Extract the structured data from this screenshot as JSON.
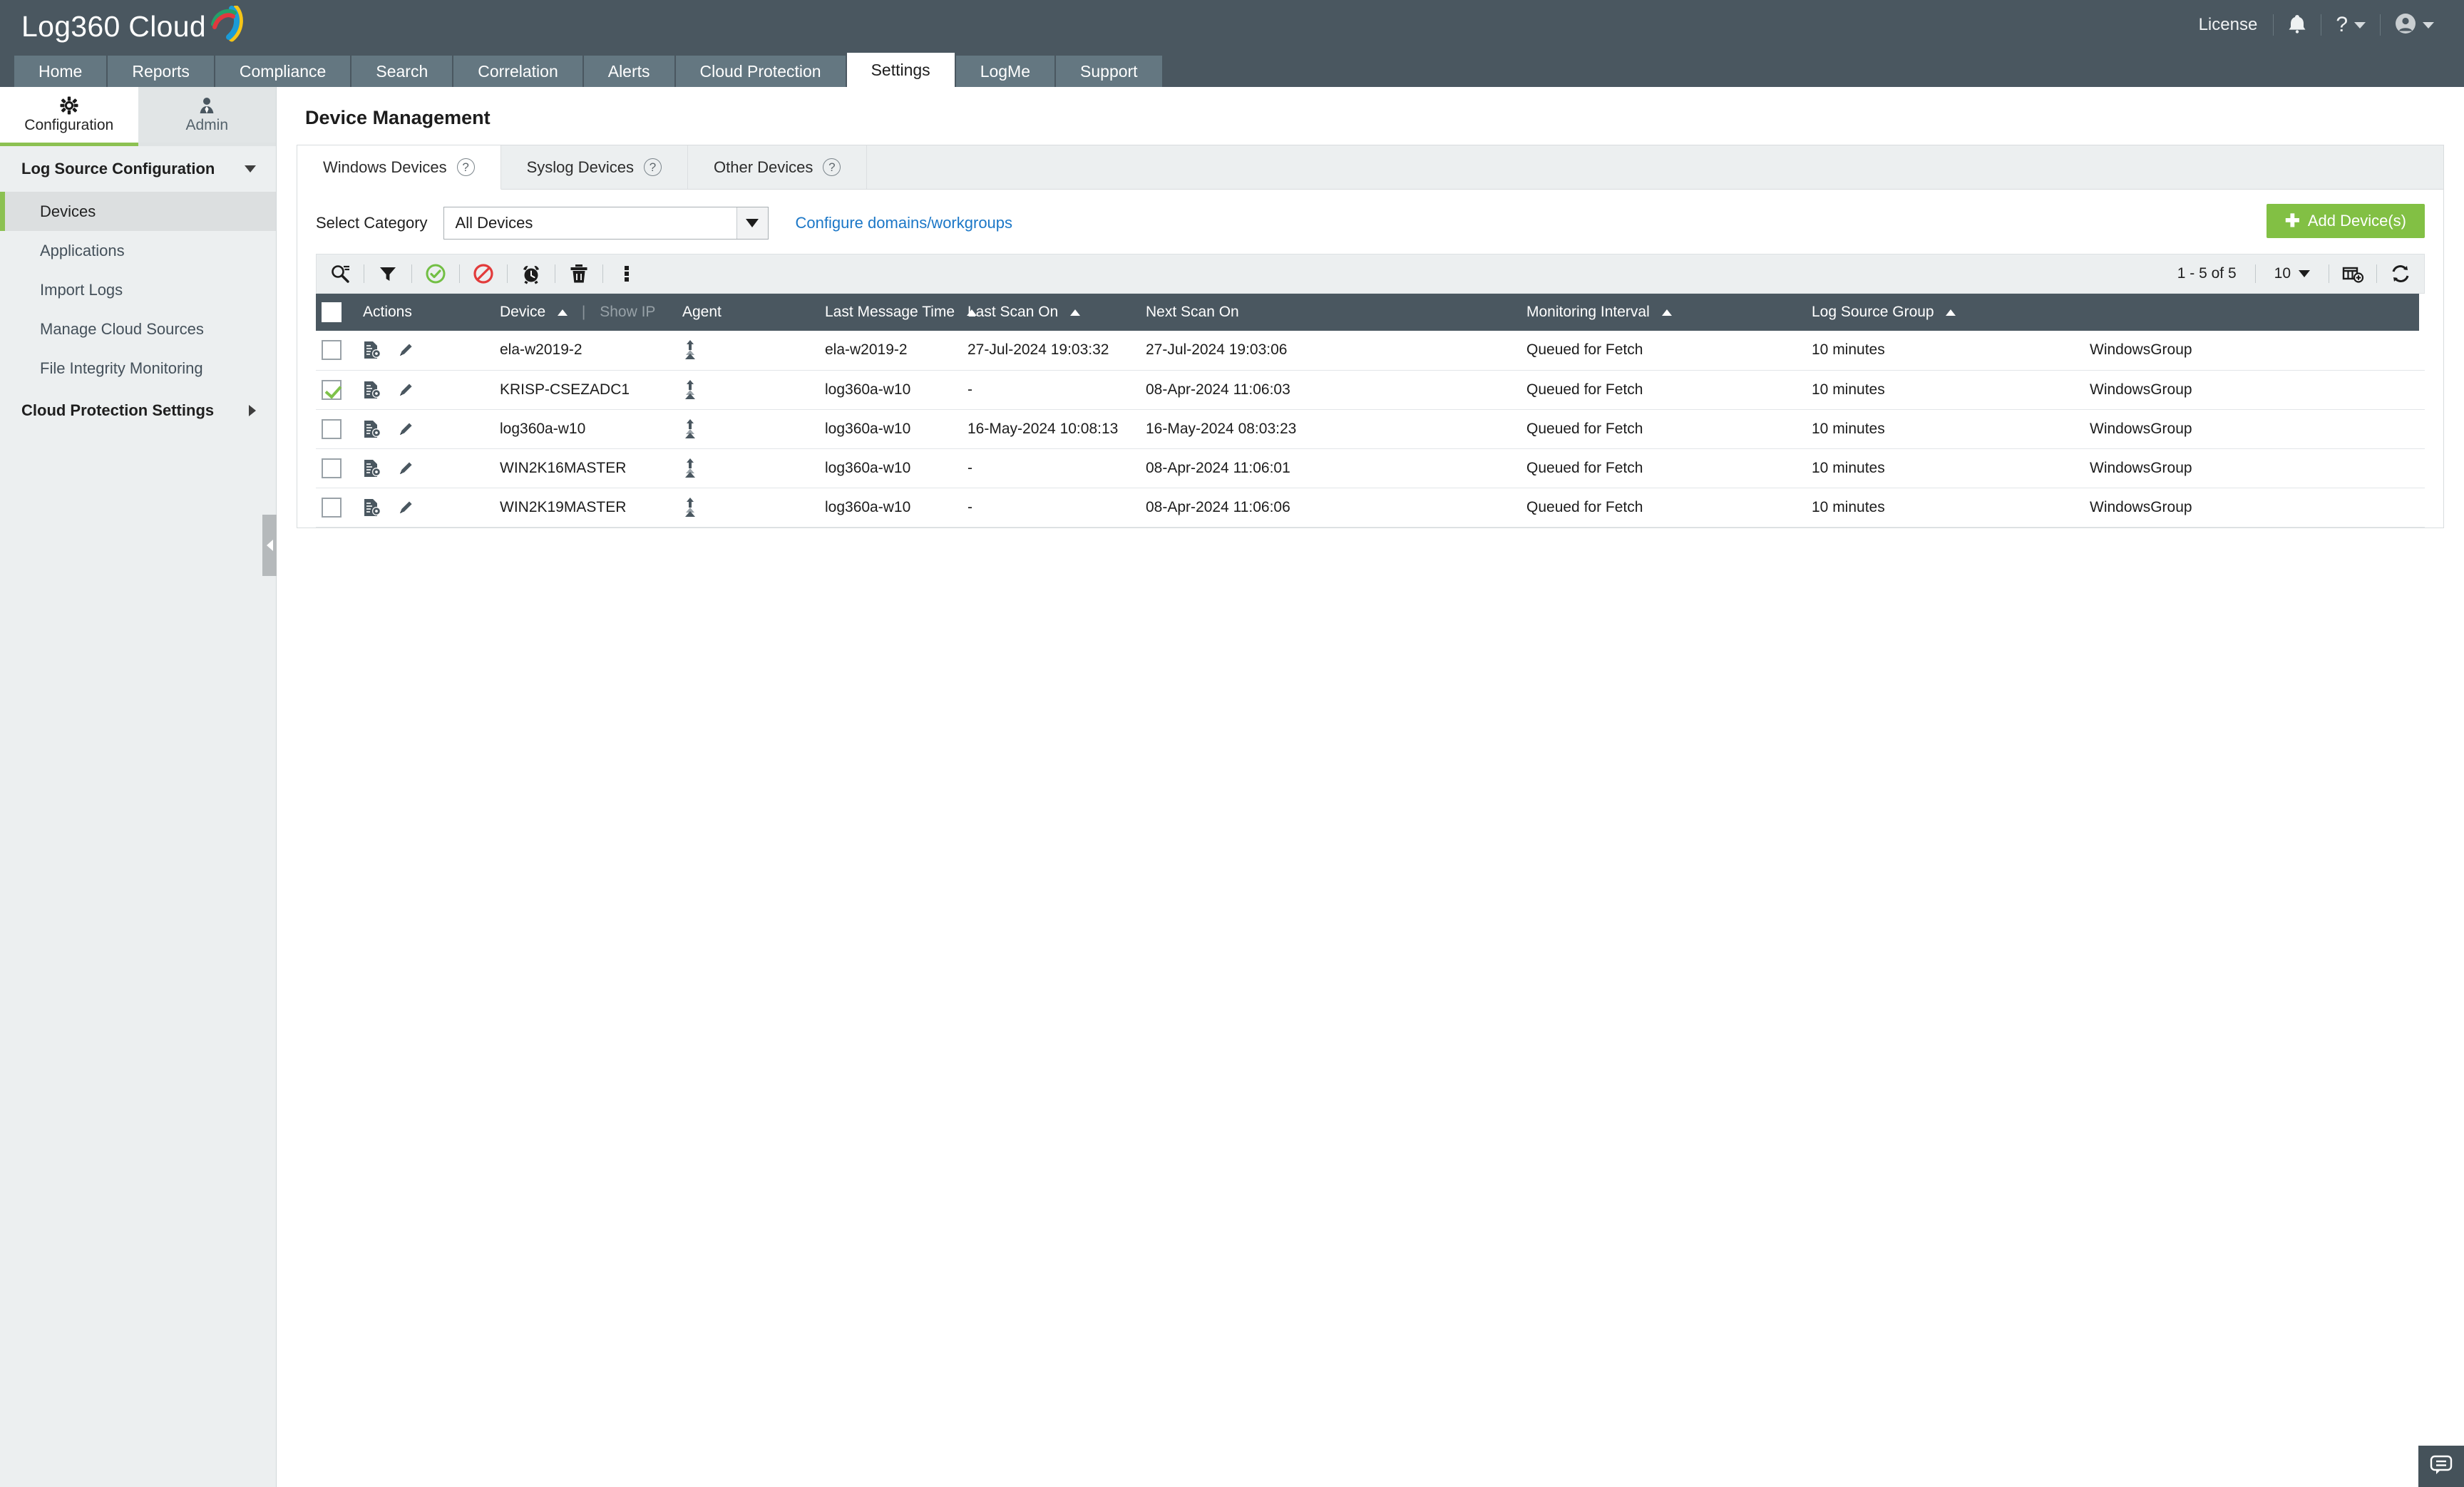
{
  "app": {
    "logo_text": "Log360 Cloud"
  },
  "topbar": {
    "license": "License",
    "notifications_icon": "bell-icon",
    "help_icon": "question-mark-icon",
    "user_icon": "user-avatar-icon"
  },
  "nav": {
    "tabs": [
      {
        "label": "Home",
        "active": false
      },
      {
        "label": "Reports",
        "active": false
      },
      {
        "label": "Compliance",
        "active": false
      },
      {
        "label": "Search",
        "active": false
      },
      {
        "label": "Correlation",
        "active": false
      },
      {
        "label": "Alerts",
        "active": false
      },
      {
        "label": "Cloud Protection",
        "active": false
      },
      {
        "label": "Settings",
        "active": true
      },
      {
        "label": "LogMe",
        "active": false
      },
      {
        "label": "Support",
        "active": false
      }
    ]
  },
  "sidebar": {
    "top_tabs": [
      {
        "label": "Configuration",
        "icon": "gear-icon",
        "active": true
      },
      {
        "label": "Admin",
        "icon": "user-tie-icon",
        "active": false
      }
    ],
    "sections": [
      {
        "label": "Log Source Configuration",
        "expanded": true,
        "items": [
          {
            "label": "Devices",
            "active": true
          },
          {
            "label": "Applications",
            "active": false
          },
          {
            "label": "Import Logs",
            "active": false
          },
          {
            "label": "Manage Cloud Sources",
            "active": false
          },
          {
            "label": "File Integrity Monitoring",
            "active": false
          }
        ]
      },
      {
        "label": "Cloud Protection Settings",
        "expanded": false,
        "items": []
      }
    ],
    "collapse_handle": "collapse-sidebar-handle"
  },
  "page": {
    "title": "Device Management"
  },
  "device_tabs": [
    {
      "label": "Windows Devices",
      "help": "?",
      "active": true
    },
    {
      "label": "Syslog Devices",
      "help": "?",
      "active": false
    },
    {
      "label": "Other Devices",
      "help": "?",
      "active": false
    }
  ],
  "filters": {
    "category_label": "Select Category",
    "category_value": "All Devices",
    "category_options": [
      "All Devices"
    ],
    "configure_link": "Configure domains/workgroups",
    "add_device_label": "Add Device(s)",
    "add_device_color": "#82c044"
  },
  "toolbar": {
    "icons": [
      "search-icon",
      "filter-icon",
      "enable-check-icon",
      "disable-block-icon",
      "alarm-clock-icon",
      "delete-trash-icon",
      "more-options-icon"
    ],
    "pager_count": "1 - 5 of 5",
    "page_size": "10",
    "column-chooser_icon": "add-column-icon",
    "refresh_icon": "refresh-icon"
  },
  "table": {
    "columns": [
      {
        "label": "",
        "name": "select-all"
      },
      {
        "label": "Actions",
        "sortable": false
      },
      {
        "label": "Device",
        "sort": "asc"
      },
      {
        "label": "Show IP",
        "muted": true
      },
      {
        "label": "Agent",
        "sortable": false
      },
      {
        "label": "Last Message Time",
        "sort": "asc"
      },
      {
        "label": "Last Scan On",
        "sort": "asc"
      },
      {
        "label": "Next Scan On",
        "sortable": false
      },
      {
        "label": "Monitoring Interval",
        "sort": "asc"
      },
      {
        "label": "Log Source Group",
        "sort": "asc"
      }
    ],
    "pipe": "|",
    "rows": [
      {
        "selected": false,
        "device": "ela-w2019-2",
        "agent": "ela-w2019-2",
        "last_message_time": "27-Jul-2024 19:03:32",
        "last_scan_on": "27-Jul-2024 19:03:06",
        "next_scan_on": "Queued for Fetch",
        "monitoring_interval": "10 minutes",
        "log_source_group": "WindowsGroup"
      },
      {
        "selected": true,
        "device": "KRISP-CSEZADC1",
        "agent": "log360a-w10",
        "last_message_time": "-",
        "last_scan_on": "08-Apr-2024 11:06:03",
        "next_scan_on": "Queued for Fetch",
        "monitoring_interval": "10 minutes",
        "log_source_group": "WindowsGroup"
      },
      {
        "selected": false,
        "device": "log360a-w10",
        "agent": "log360a-w10",
        "last_message_time": "16-May-2024 10:08:13",
        "last_scan_on": "16-May-2024 08:03:23",
        "next_scan_on": "Queued for Fetch",
        "monitoring_interval": "10 minutes",
        "log_source_group": "WindowsGroup"
      },
      {
        "selected": false,
        "device": "WIN2K16MASTER",
        "agent": "log360a-w10",
        "last_message_time": "-",
        "last_scan_on": "08-Apr-2024 11:06:01",
        "next_scan_on": "Queued for Fetch",
        "monitoring_interval": "10 minutes",
        "log_source_group": "WindowsGroup"
      },
      {
        "selected": false,
        "device": "WIN2K19MASTER",
        "agent": "log360a-w10",
        "last_message_time": "-",
        "last_scan_on": "08-Apr-2024 11:06:06",
        "next_scan_on": "Queued for Fetch",
        "monitoring_interval": "10 minutes",
        "log_source_group": "WindowsGroup"
      }
    ]
  },
  "footer": {
    "chat_icon": "chat-bubble-icon"
  },
  "colors": {
    "header_bg": "#4a5760",
    "nav_tab_bg": "#647781",
    "accent_green": "#8cc152",
    "link_blue": "#1b77c7",
    "table_header_bg": "#4a5760"
  }
}
